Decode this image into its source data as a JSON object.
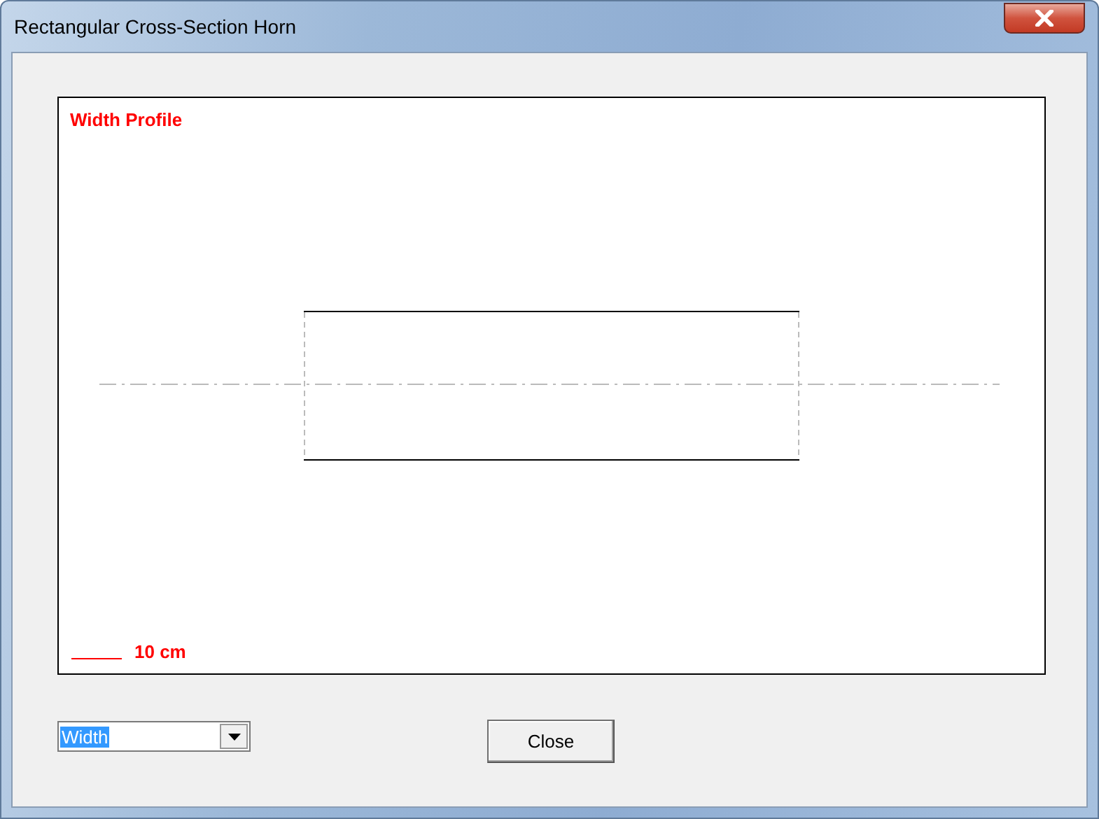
{
  "window": {
    "title": "Rectangular Cross-Section Horn"
  },
  "plot": {
    "title": "Width Profile",
    "scale_label": "10 cm"
  },
  "profile_select": {
    "value": "Width"
  },
  "buttons": [
    "Close"
  ]
}
